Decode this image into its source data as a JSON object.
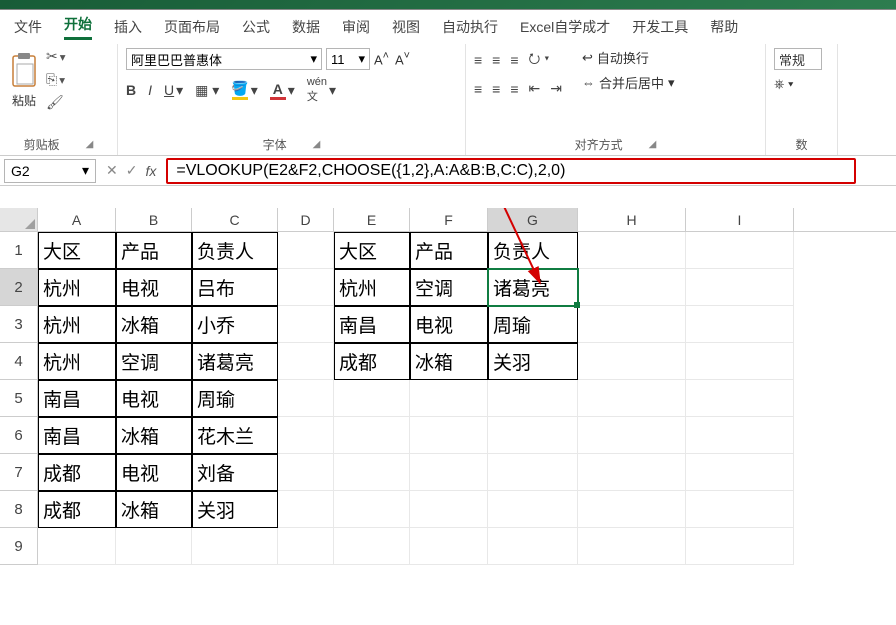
{
  "tabs": {
    "file": "文件",
    "home": "开始",
    "insert": "插入",
    "layout": "页面布局",
    "formulas": "公式",
    "data": "数据",
    "review": "审阅",
    "view": "视图",
    "auto": "自动执行",
    "custom": "Excel自学成才",
    "dev": "开发工具",
    "help": "帮助"
  },
  "ribbon": {
    "clipboard": {
      "paste": "粘贴",
      "label": "剪贴板"
    },
    "font": {
      "name": "阿里巴巴普惠体",
      "size": "11",
      "label": "字体"
    },
    "align": {
      "wrap": "自动换行",
      "merge": "合并后居中",
      "label": "对齐方式"
    },
    "number": {
      "general": "常规",
      "label": "数"
    }
  },
  "namebox": "G2",
  "formula": "=VLOOKUP(E2&F2,CHOOSE({1,2},A:A&B:B,C:C),2,0)",
  "cols": [
    "A",
    "B",
    "C",
    "D",
    "E",
    "F",
    "G",
    "H",
    "I"
  ],
  "rows": [
    "1",
    "2",
    "3",
    "4",
    "5",
    "6",
    "7",
    "8",
    "9"
  ],
  "table1": {
    "h": [
      "大区",
      "产品",
      "负责人"
    ],
    "r": [
      [
        "杭州",
        "电视",
        "吕布"
      ],
      [
        "杭州",
        "冰箱",
        "小乔"
      ],
      [
        "杭州",
        "空调",
        "诸葛亮"
      ],
      [
        "南昌",
        "电视",
        "周瑜"
      ],
      [
        "南昌",
        "冰箱",
        "花木兰"
      ],
      [
        "成都",
        "电视",
        "刘备"
      ],
      [
        "成都",
        "冰箱",
        "关羽"
      ]
    ]
  },
  "table2": {
    "h": [
      "大区",
      "产品",
      "负责人"
    ],
    "r": [
      [
        "杭州",
        "空调",
        "诸葛亮"
      ],
      [
        "南昌",
        "电视",
        "周瑜"
      ],
      [
        "成都",
        "冰箱",
        "关羽"
      ]
    ]
  },
  "chart_data": {
    "type": "table",
    "tables": [
      {
        "columns": [
          "大区",
          "产品",
          "负责人"
        ],
        "rows": [
          [
            "杭州",
            "电视",
            "吕布"
          ],
          [
            "杭州",
            "冰箱",
            "小乔"
          ],
          [
            "杭州",
            "空调",
            "诸葛亮"
          ],
          [
            "南昌",
            "电视",
            "周瑜"
          ],
          [
            "南昌",
            "冰箱",
            "花木兰"
          ],
          [
            "成都",
            "电视",
            "刘备"
          ],
          [
            "成都",
            "冰箱",
            "关羽"
          ]
        ]
      },
      {
        "columns": [
          "大区",
          "产品",
          "负责人"
        ],
        "rows": [
          [
            "杭州",
            "空调",
            "诸葛亮"
          ],
          [
            "南昌",
            "电视",
            "周瑜"
          ],
          [
            "成都",
            "冰箱",
            "关羽"
          ]
        ]
      }
    ]
  }
}
